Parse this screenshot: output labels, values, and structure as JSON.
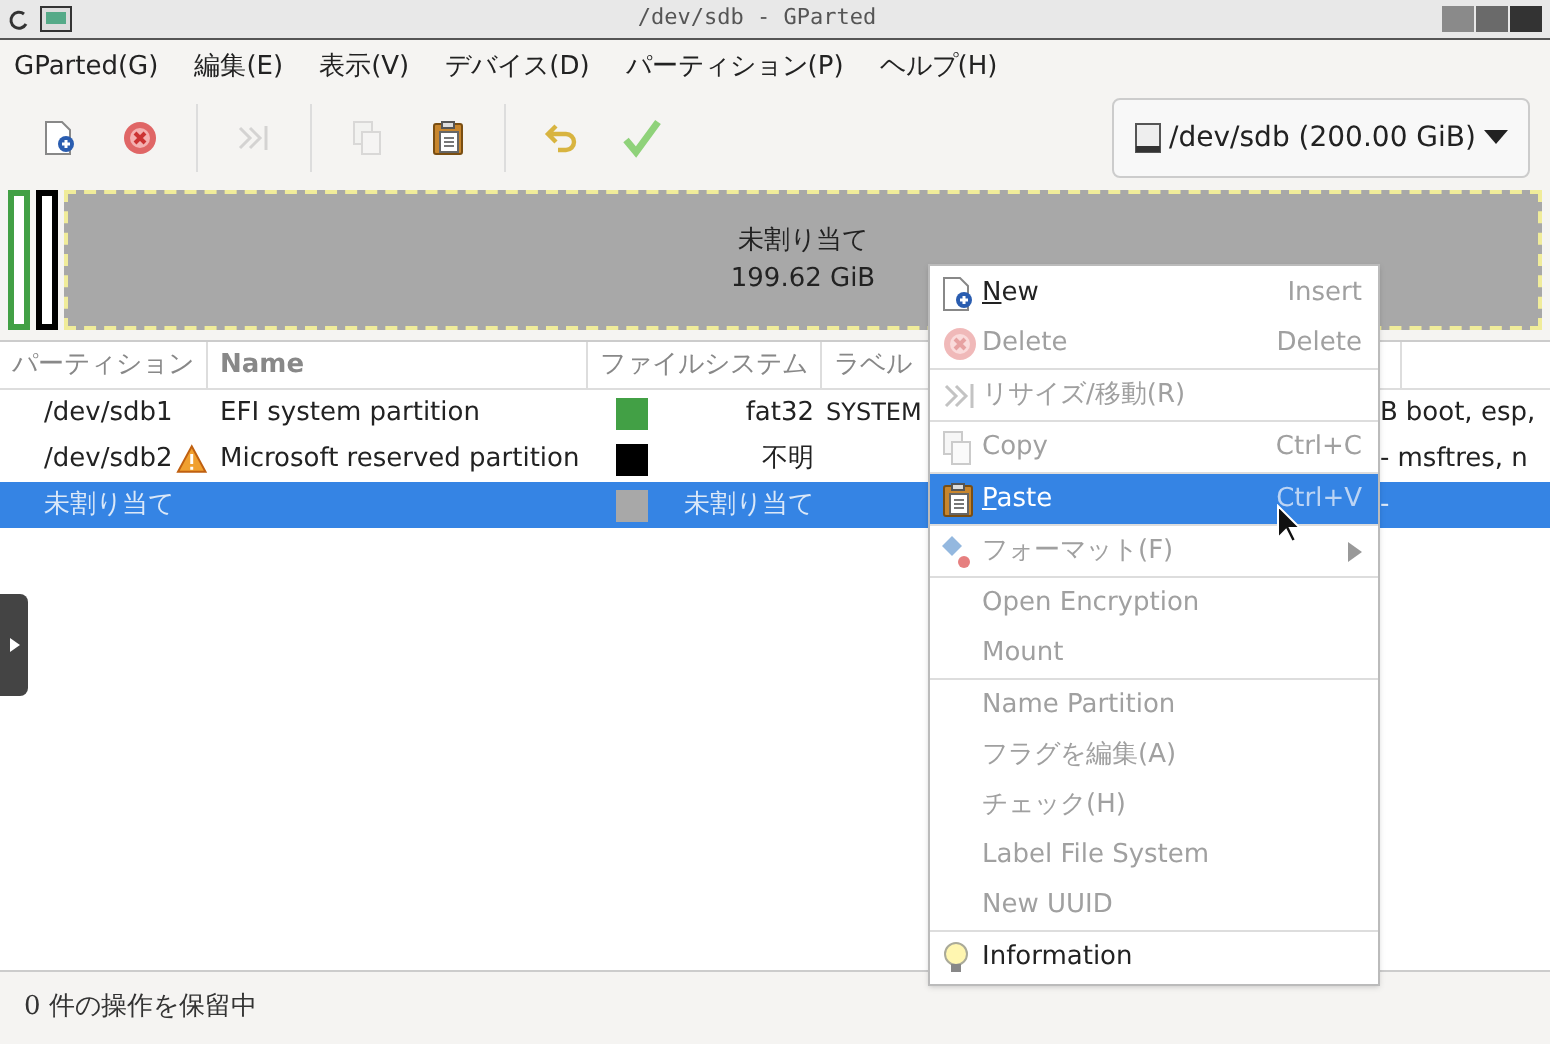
{
  "window": {
    "title": "/dev/sdb - GParted"
  },
  "menubar": [
    "GParted(G)",
    "編集(E)",
    "表示(V)",
    "デバイス(D)",
    "パーティション(P)",
    "ヘルプ(H)"
  ],
  "toolbar": [
    {
      "kind": "new",
      "disabled": false
    },
    {
      "kind": "delete",
      "disabled": false
    },
    {
      "kind": "sep"
    },
    {
      "kind": "resize",
      "disabled": true
    },
    {
      "kind": "sep"
    },
    {
      "kind": "copy",
      "disabled": true
    },
    {
      "kind": "paste",
      "disabled": false
    },
    {
      "kind": "sep"
    },
    {
      "kind": "undo",
      "disabled": false
    },
    {
      "kind": "apply",
      "disabled": false
    }
  ],
  "device_selector": {
    "value": "/dev/sdb (200.00 GiB)"
  },
  "disk_map": {
    "partitions": [
      {
        "color": "#42a045"
      },
      {
        "color": "#000000"
      }
    ],
    "unallocated": {
      "label": "未割り当て",
      "size": "199.62 GiB"
    }
  },
  "table": {
    "columns": [
      "パーティション",
      "Name",
      "ファイルシステム",
      "ラベル"
    ],
    "rows": [
      {
        "partition": "/dev/sdb1",
        "warning": false,
        "name": "EFI system partition",
        "color": "#42a045",
        "filesystem": "fat32",
        "label": "SYSTEM",
        "column_5": "B",
        "flags": "boot, esp,",
        "selected": false
      },
      {
        "partition": "/dev/sdb2",
        "warning": true,
        "name": "Microsoft reserved partition",
        "color": "#000000",
        "filesystem": "不明",
        "label": "",
        "column_5": "-",
        "flags": "msftres, n",
        "selected": false
      },
      {
        "partition": "未割り当て",
        "warning": false,
        "name": "",
        "color": "#a8a8a8",
        "filesystem": "未割り当て",
        "label": "",
        "column_5": "-",
        "flags": "",
        "selected": true
      }
    ]
  },
  "context_menu": [
    {
      "kind": "item",
      "label": "New",
      "mnemonic_underlined": true,
      "shortcut": "Insert",
      "disabled": false,
      "selected": false
    },
    {
      "kind": "item",
      "label": "Delete",
      "shortcut": "Delete",
      "disabled": true,
      "selected": false
    },
    {
      "kind": "separator"
    },
    {
      "kind": "item",
      "label": "リサイズ/移動(R)",
      "disabled": true,
      "selected": false
    },
    {
      "kind": "separator"
    },
    {
      "kind": "item",
      "label": "Copy",
      "shortcut": "Ctrl+C",
      "disabled": true,
      "selected": false
    },
    {
      "kind": "separator"
    },
    {
      "kind": "item",
      "label": "Paste",
      "mnemonic_underlined": true,
      "shortcut": "Ctrl+V",
      "disabled": false,
      "selected": true
    },
    {
      "kind": "separator"
    },
    {
      "kind": "item",
      "label": "フォーマット(F)",
      "submenu": true,
      "disabled": true,
      "selected": false
    },
    {
      "kind": "separator"
    },
    {
      "kind": "item",
      "label": "Open Encryption",
      "disabled": true,
      "selected": false
    },
    {
      "kind": "item",
      "label": "Mount",
      "disabled": true,
      "selected": false
    },
    {
      "kind": "separator"
    },
    {
      "kind": "item",
      "label": "Name Partition",
      "disabled": true,
      "selected": false
    },
    {
      "kind": "item",
      "label": "フラグを編集(A)",
      "disabled": true,
      "selected": false
    },
    {
      "kind": "item",
      "label": "チェック(H)",
      "disabled": true,
      "selected": false
    },
    {
      "kind": "item",
      "label": "Label File System",
      "disabled": true,
      "selected": false
    },
    {
      "kind": "item",
      "label": "New UUID",
      "disabled": true,
      "selected": false
    },
    {
      "kind": "separator"
    },
    {
      "kind": "item",
      "label": "Information",
      "disabled": false,
      "selected": false
    }
  ],
  "status_bar": "0 件の操作を保留中"
}
